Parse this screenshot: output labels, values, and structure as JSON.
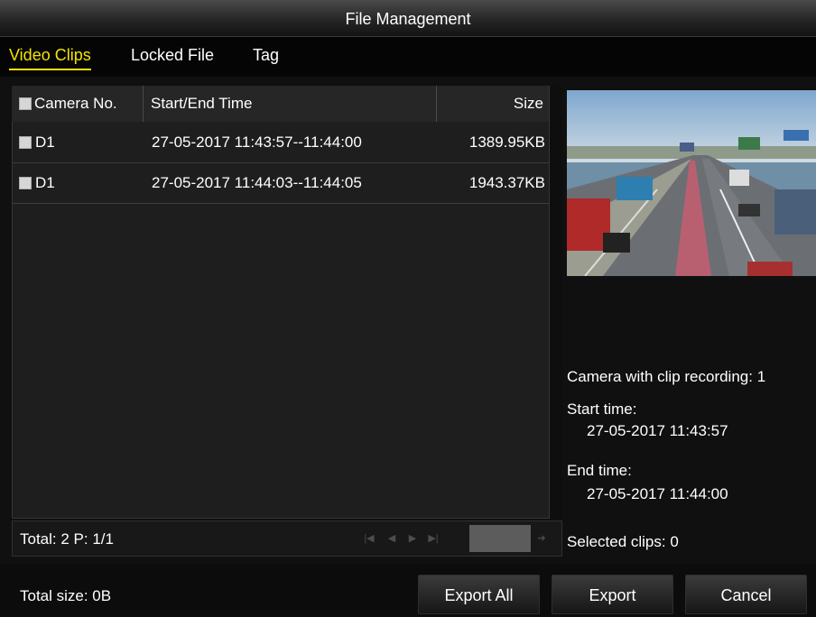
{
  "window": {
    "title": "File Management"
  },
  "tabs": [
    {
      "label": "Video Clips",
      "active": true
    },
    {
      "label": "Locked File",
      "active": false
    },
    {
      "label": "Tag",
      "active": false
    }
  ],
  "table": {
    "headers": {
      "camera": "Camera No.",
      "time": "Start/End Time",
      "size": "Size"
    },
    "rows": [
      {
        "camera": "D1",
        "time": "27-05-2017 11:43:57--11:44:00",
        "size": "1389.95KB",
        "checked": false
      },
      {
        "camera": "D1",
        "time": "27-05-2017 11:44:03--11:44:05",
        "size": "1943.37KB",
        "checked": false
      }
    ]
  },
  "pagination": {
    "total_label": "Total: 2  P: 1/1",
    "page_input": ""
  },
  "info": {
    "camera_with_clip": "Camera with clip recording: 1",
    "start_label": "Start time:",
    "start_value": "27-05-2017 11:43:57",
    "end_label": "End time:",
    "end_value": "27-05-2017 11:44:00",
    "selected": "Selected clips: 0"
  },
  "footer": {
    "total_size": "Total size: 0B",
    "export_all_label": "Export All",
    "export_label": "Export",
    "cancel_label": "Cancel"
  },
  "colors": {
    "active_tab": "#f4e300",
    "background": "#000000",
    "panel": "#1e1e1e"
  },
  "icons": [
    "first-page-icon",
    "prev-page-icon",
    "next-page-icon",
    "last-page-icon",
    "go-arrow-icon"
  ]
}
